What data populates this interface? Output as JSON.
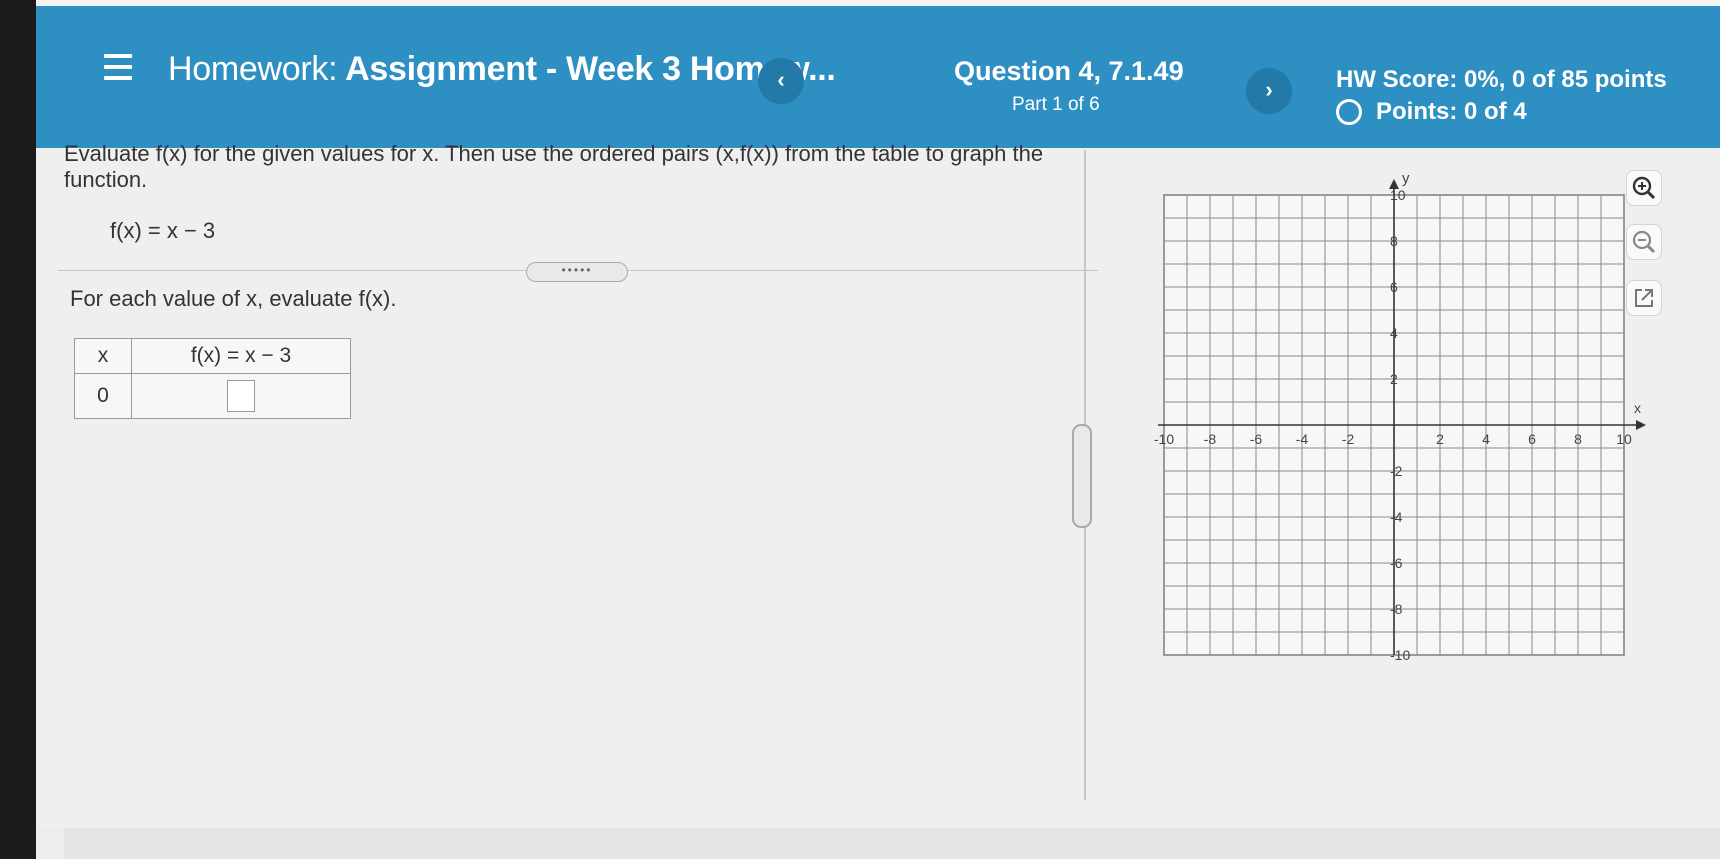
{
  "header": {
    "title_prefix": "Homework:",
    "title": "Assignment - Week 3 Homew...",
    "question_label": "Question 4, 7.1.49",
    "part_label": "Part 1 of 6",
    "hw_score": "HW Score: 0%, 0 of 85 points",
    "points": "Points: 0 of 4",
    "prev_label": "‹",
    "next_label": "›"
  },
  "problem": {
    "prompt": "Evaluate f(x) for the given values for x.  Then use the ordered pairs (x,f(x)) from the table to graph the function.",
    "function": "f(x) = x − 3",
    "divider_handle": "•••••",
    "instruction": "For each value of x, evaluate f(x)."
  },
  "table": {
    "col_x": "x",
    "col_fx": "f(x) = x − 3",
    "rows": [
      {
        "x": "0",
        "fx": ""
      }
    ]
  },
  "graph": {
    "xlabel": "x",
    "ylabel": "y",
    "xlim": [
      -10,
      10
    ],
    "ylim": [
      -10,
      10
    ],
    "x_ticks": [
      "-10",
      "-8",
      "-6",
      "-4",
      "-2",
      "2",
      "4",
      "6",
      "8",
      "10"
    ],
    "y_ticks": [
      "10",
      "8",
      "6",
      "4",
      "2",
      "-2",
      "-4",
      "-6",
      "-8",
      "-10"
    ],
    "grid": true
  },
  "tools": {
    "zoom_in": "zoom-in-icon",
    "zoom_out": "zoom-out-icon",
    "popout": "popout-icon"
  },
  "colors": {
    "header_bg": "#2e8fc3",
    "nav_button": "#237aa8"
  }
}
